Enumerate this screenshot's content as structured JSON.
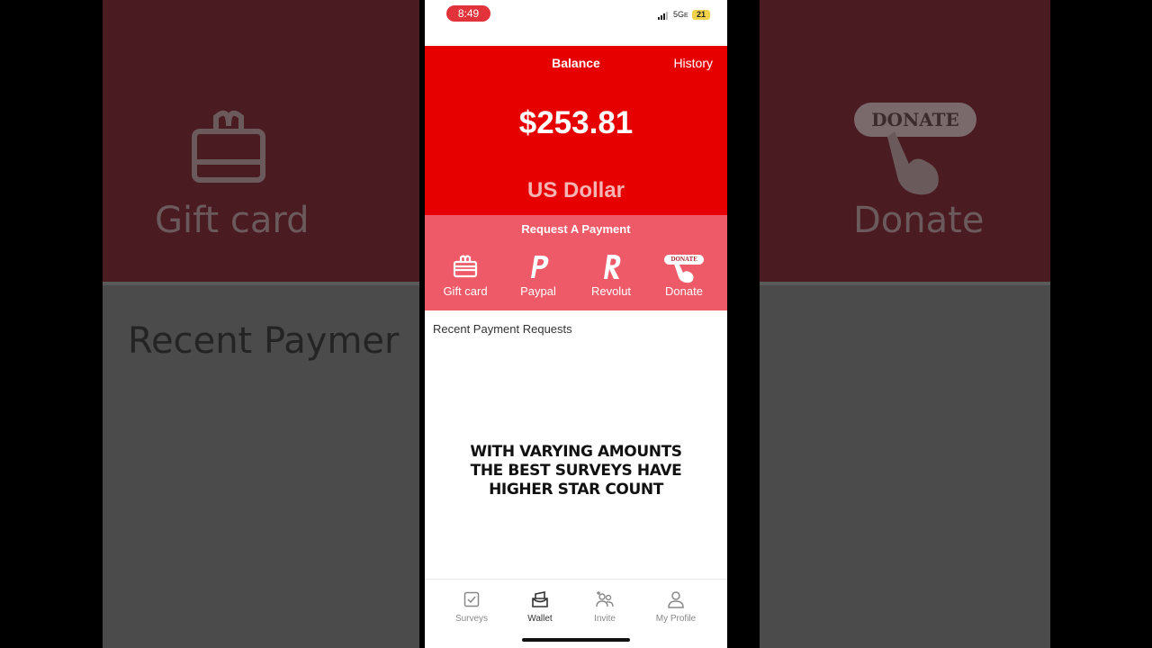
{
  "status_bar": {
    "time": "8:49",
    "network": "5G",
    "network_suffix": "E",
    "battery": "21"
  },
  "header": {
    "title": "Balance",
    "history_label": "History"
  },
  "balance": {
    "amount": "$253.81",
    "currency": "US Dollar"
  },
  "request_payment": {
    "title": "Request A Payment",
    "options": [
      {
        "label": "Gift card",
        "icon": "gift-card-icon"
      },
      {
        "label": "Paypal",
        "icon": "paypal-icon"
      },
      {
        "label": "Revolut",
        "icon": "revolut-icon"
      },
      {
        "label": "Donate",
        "icon": "donate-icon",
        "badge": "DONATE"
      }
    ]
  },
  "recent": {
    "title": "Recent Payment Requests"
  },
  "caption": {
    "lines": [
      "WITH VARYING AMOUNTS",
      "THE BEST SURVEYS HAVE",
      "HIGHER STAR COUNT"
    ]
  },
  "tab_bar": {
    "items": [
      {
        "label": "Surveys",
        "icon": "checkbox-icon"
      },
      {
        "label": "Wallet",
        "icon": "wallet-icon",
        "active": true
      },
      {
        "label": "Invite",
        "icon": "invite-icon"
      },
      {
        "label": "My Profile",
        "icon": "profile-icon"
      }
    ]
  },
  "background": {
    "left_label": "Gift card",
    "right_label": "Donate",
    "right_badge": "DONATE",
    "recent_partial": "Recent Paymer"
  },
  "colors": {
    "primary_red": "#e60000",
    "request_pink": "#ef5a68",
    "time_pill": "#e2323a"
  }
}
